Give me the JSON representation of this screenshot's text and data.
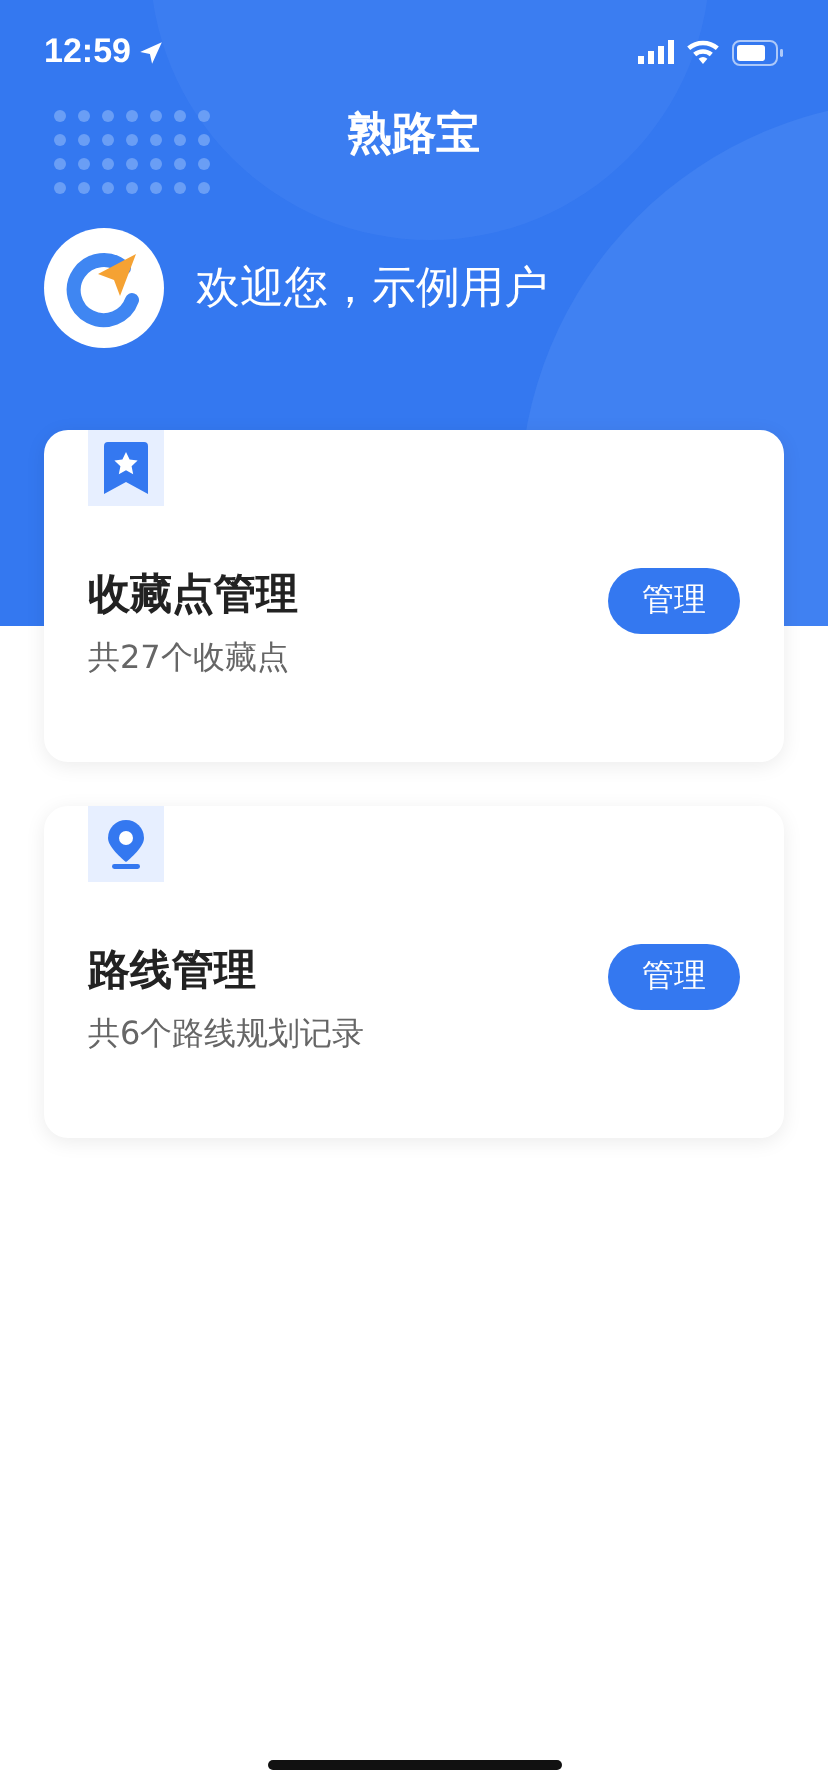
{
  "status_bar": {
    "time": "12:59"
  },
  "header": {
    "app_title": "熟路宝",
    "greeting": "欢迎您，示例用户"
  },
  "cards": [
    {
      "kind": "bookmark",
      "title": "收藏点管理",
      "subtitle": "共27个收藏点",
      "button": "管理"
    },
    {
      "kind": "pin",
      "title": "路线管理",
      "subtitle": "共6个路线规划记录",
      "button": "管理"
    }
  ]
}
